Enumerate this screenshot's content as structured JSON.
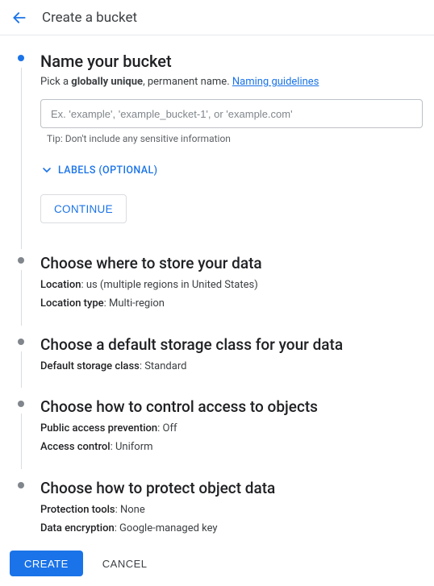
{
  "header": {
    "title": "Create a bucket"
  },
  "step1": {
    "title": "Name your bucket",
    "desc_prefix": "Pick a ",
    "desc_bold": "globally unique",
    "desc_suffix": ", permanent name. ",
    "guidelines_link": "Naming guidelines",
    "input_placeholder": "Ex. 'example', 'example_bucket-1', or 'example.com'",
    "tip": "Tip: Don't include any sensitive information",
    "labels_toggle": "LABELS (OPTIONAL)",
    "continue": "CONTINUE"
  },
  "step2": {
    "title": "Choose where to store your data",
    "location_key": "Location",
    "location_val": ": us (multiple regions in United States)",
    "location_type_key": "Location type",
    "location_type_val": ": Multi-region"
  },
  "step3": {
    "title": "Choose a default storage class for your data",
    "class_key": "Default storage class",
    "class_val": ": Standard"
  },
  "step4": {
    "title": "Choose how to control access to objects",
    "pap_key": "Public access prevention",
    "pap_val": ": Off",
    "ac_key": "Access control",
    "ac_val": ": Uniform"
  },
  "step5": {
    "title": "Choose how to protect object data",
    "pt_key": "Protection tools",
    "pt_val": ": None",
    "de_key": "Data encryption",
    "de_val": ": Google-managed key"
  },
  "footer": {
    "create": "CREATE",
    "cancel": "CANCEL"
  }
}
